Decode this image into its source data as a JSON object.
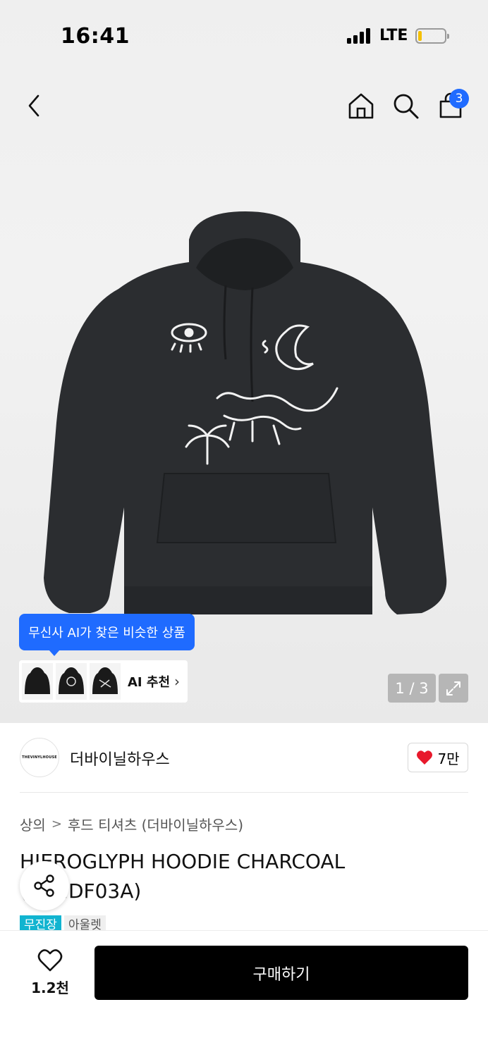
{
  "status": {
    "time": "16:41",
    "network": "LTE"
  },
  "nav": {
    "cart_count": "3"
  },
  "product": {
    "image_alt": "charcoal hoodie",
    "page_indicator": "1 / 3",
    "ai": {
      "tooltip": "무신사 AI가 찾은 비슷한 상품",
      "label": "AI 추천"
    },
    "brand": {
      "name": "더바이닐하우스",
      "logo_text": "THEVINYLHOUSE"
    },
    "likes": "7만",
    "breadcrumb": [
      "상의",
      "후드 티셔츠 (더바이닐하우스)"
    ],
    "title": "HIEROGLYPH HOODIE CHARCOAL (VH2DF03A)",
    "tags": [
      "무진장",
      "아울렛"
    ]
  },
  "bottom": {
    "wish_count": "1.2천",
    "buy_label": "구매하기"
  },
  "colors": {
    "accent": "#1f6bff",
    "heart": "#e8192c",
    "tag": "#11b4d0"
  }
}
